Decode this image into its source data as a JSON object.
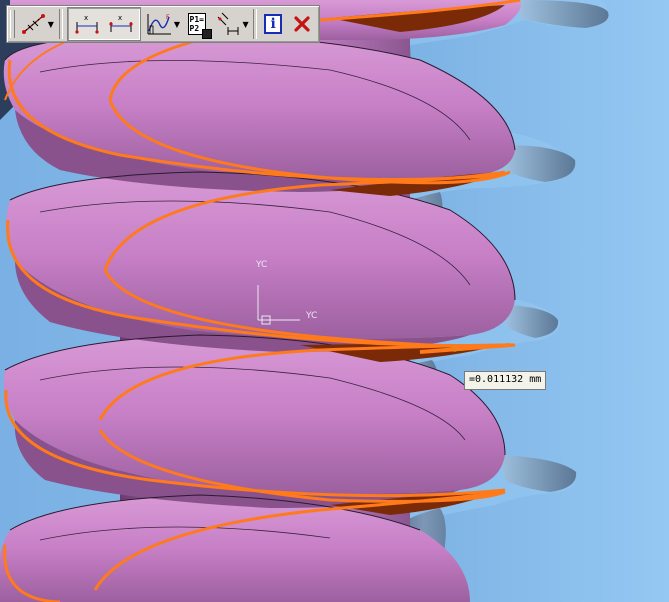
{
  "toolbar": {
    "buttons": [
      {
        "id": "point-on-curve",
        "icon": "measure-points-icon",
        "has_dropdown": true
      },
      {
        "id": "distance-x",
        "icon": "distance-x-icon",
        "pressed": true
      },
      {
        "id": "distance-x-alt",
        "icon": "distance-x-alt-icon",
        "pressed": true
      },
      {
        "id": "curve-analysis",
        "icon": "curve-analysis-icon",
        "has_dropdown": true
      },
      {
        "id": "save-p1-p2",
        "icon": "save-p1-p2-icon",
        "label_top": "P1=",
        "label_bottom": "P2"
      },
      {
        "id": "dimension",
        "icon": "dimension-icon",
        "has_dropdown": true
      },
      {
        "id": "info",
        "icon": "info-icon",
        "label": "i"
      },
      {
        "id": "close",
        "icon": "close-icon",
        "color": "#c41414"
      }
    ]
  },
  "measurement": {
    "value_text": "=0.011132 mm"
  },
  "axis_triad": {
    "yc_label": "YC",
    "xc_label": "YC"
  },
  "colors": {
    "background": "#8fc2ee",
    "insulator_body": "#c77fc6",
    "insulator_shadow": "#7d4a82",
    "steel_gray": "#6f8aa8",
    "helix_curve": "#ff7a1a",
    "gap_fill": "#7a2a06",
    "close_red": "#c41414",
    "info_blue": "#1a2db5"
  }
}
